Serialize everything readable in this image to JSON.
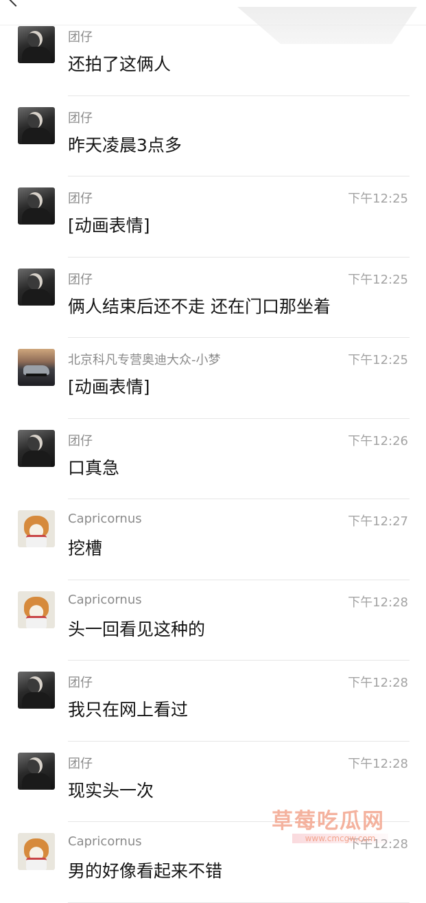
{
  "messages": [
    {
      "avatar": "person",
      "name": "团仔",
      "time": "",
      "text": "还拍了这俩人"
    },
    {
      "avatar": "person",
      "name": "团仔",
      "time": "",
      "text": "昨天凌晨3点多"
    },
    {
      "avatar": "person",
      "name": "团仔",
      "time": "下午12:25",
      "text": "[动画表情]"
    },
    {
      "avatar": "person",
      "name": "团仔",
      "time": "下午12:25",
      "text": "俩人结束后还不走 还在门口那坐着"
    },
    {
      "avatar": "car",
      "name": "北京科凡专营奥迪大众-小梦",
      "time": "下午12:25",
      "text": "[动画表情]"
    },
    {
      "avatar": "person",
      "name": "团仔",
      "time": "下午12:26",
      "text": "口真急"
    },
    {
      "avatar": "dog",
      "name": "Capricornus",
      "time": "下午12:27",
      "text": "挖槽"
    },
    {
      "avatar": "dog",
      "name": "Capricornus",
      "time": "下午12:28",
      "text": "头一回看见这种的"
    },
    {
      "avatar": "person",
      "name": "团仔",
      "time": "下午12:28",
      "text": "我只在网上看过"
    },
    {
      "avatar": "person",
      "name": "团仔",
      "time": "下午12:28",
      "text": "现实头一次"
    },
    {
      "avatar": "dog",
      "name": "Capricornus",
      "time": "下午12:28",
      "text": "男的好像看起来不错"
    }
  ],
  "watermark": {
    "title": "草莓吃瓜网",
    "url": "www.cmcgw.com"
  }
}
